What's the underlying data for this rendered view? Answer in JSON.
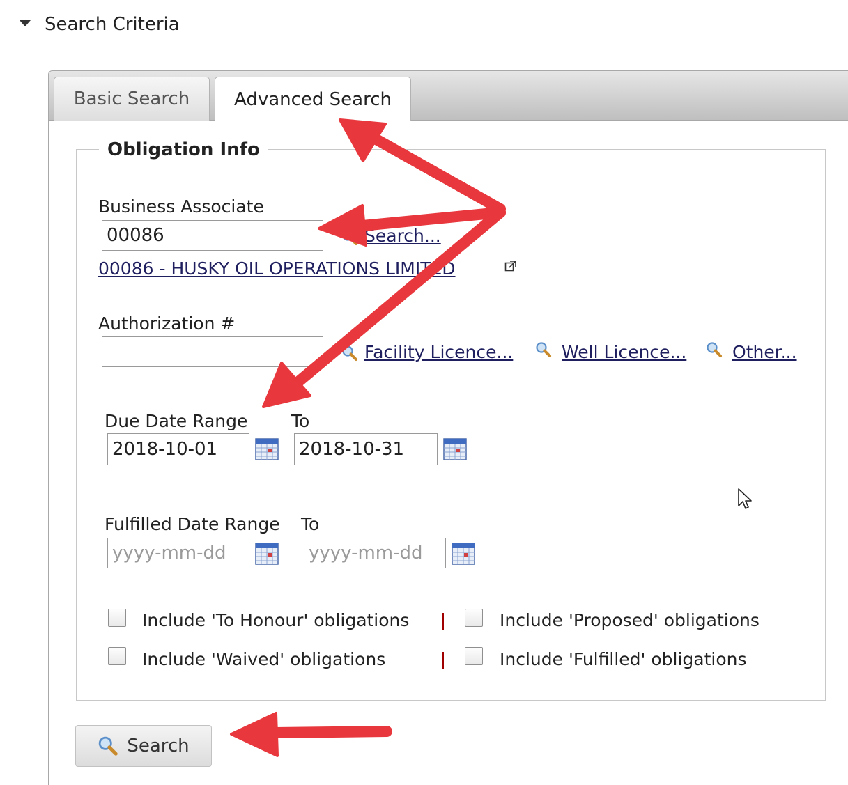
{
  "header": {
    "title": "Search Criteria"
  },
  "tabs": [
    {
      "label": "Basic Search"
    },
    {
      "label": "Advanced Search"
    }
  ],
  "fieldset": {
    "legend": "Obligation Info"
  },
  "business_associate": {
    "label": "Business Associate",
    "value": "00086",
    "search_link": "Search...",
    "result_link": "00086 - HUSKY OIL OPERATIONS LIMITED "
  },
  "authorization": {
    "label": "Authorization #",
    "value": "",
    "links": [
      "Facility Licence...",
      "Well Licence...",
      "Other..."
    ]
  },
  "due_date": {
    "label": "Due Date Range",
    "to_label": "To",
    "from_value": "2018-10-01",
    "to_value": "2018-10-31"
  },
  "fulfilled_date": {
    "label": "Fulfilled Date Range",
    "to_label": "To",
    "from_placeholder": "yyyy-mm-dd",
    "to_placeholder": "yyyy-mm-dd"
  },
  "checkboxes": [
    {
      "label": "Include 'To Honour' obligations",
      "checked": false
    },
    {
      "label": "Include 'Proposed' obligations",
      "checked": false
    },
    {
      "label": "Include 'Waived' obligations",
      "checked": false
    },
    {
      "label": "Include 'Fulfilled' obligations",
      "checked": false
    }
  ],
  "search_button": {
    "label": "Search"
  },
  "colors": {
    "annotation_arrow": "#e8383d",
    "separator": "#a00000"
  }
}
